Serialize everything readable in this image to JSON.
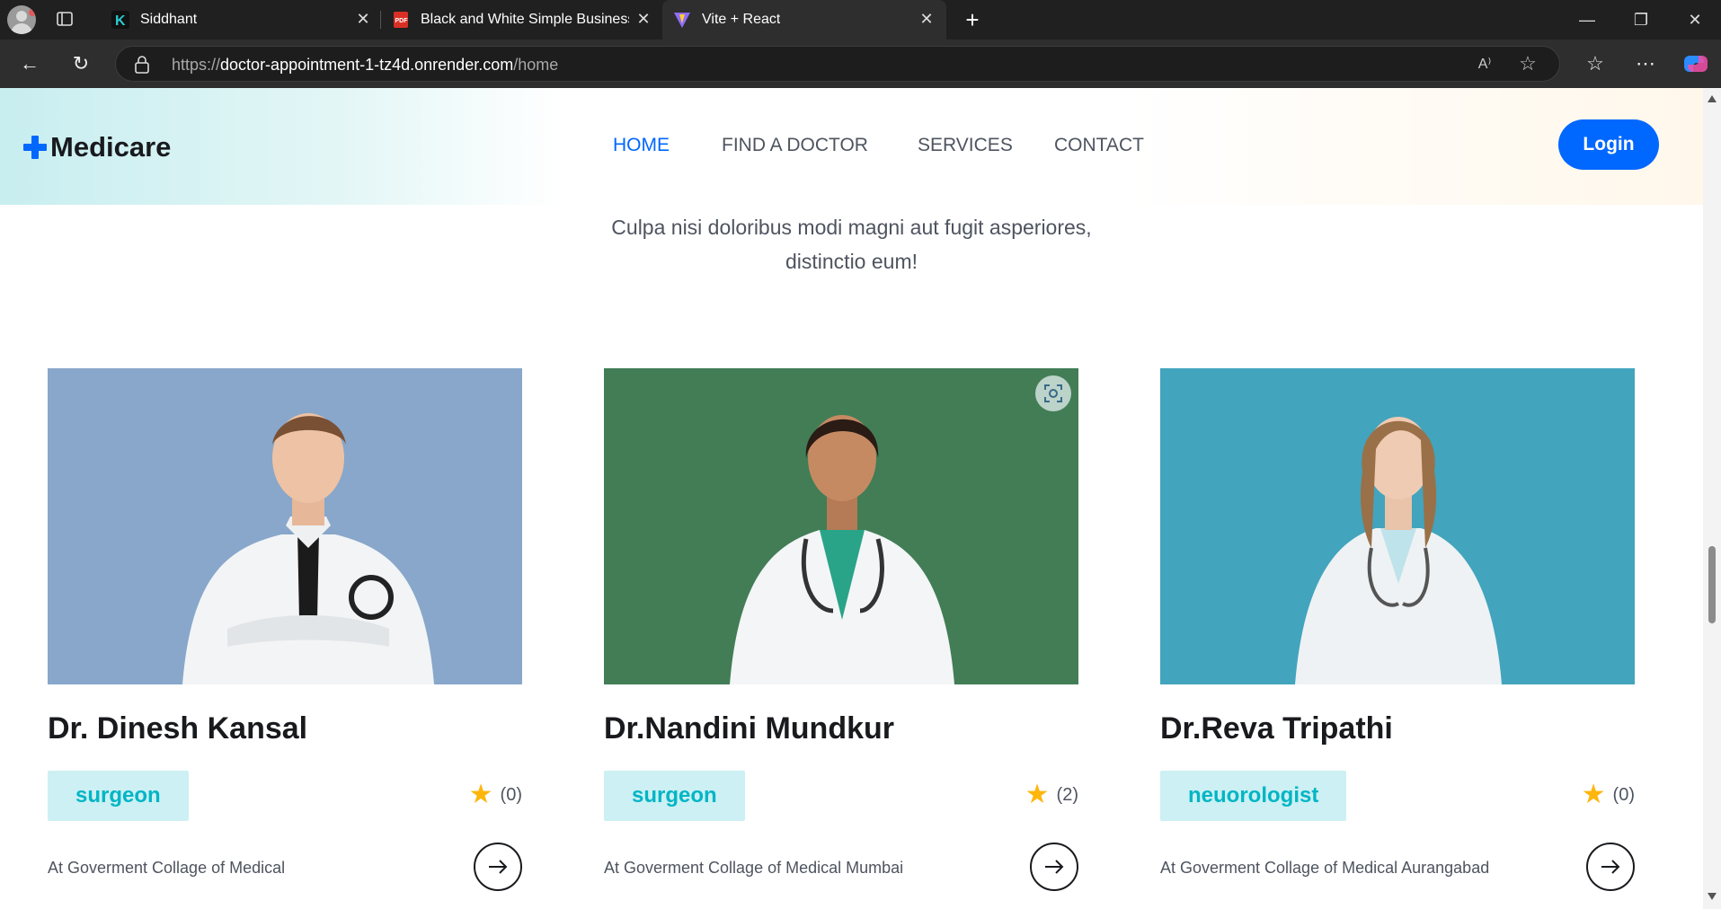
{
  "browser": {
    "tabs": [
      {
        "title": "Siddhant",
        "favicon": "k-logo-icon"
      },
      {
        "title": "Black and White Simple Business",
        "favicon": "pdf-icon"
      },
      {
        "title": "Vite + React",
        "favicon": "vite-icon",
        "active": true
      }
    ],
    "url_prefix": "https://",
    "url_host": "doctor-appointment-1-tz4d.onrender.com",
    "url_path": "/home"
  },
  "site": {
    "logo": "Medicare",
    "nav": [
      "HOME",
      "FIND A DOCTOR",
      "SERVICES",
      "CONTACT"
    ],
    "active_nav": "HOME",
    "login_label": "Login",
    "hero_lines": [
      "Culpa nisi doloribus modi magni aut fugit asperiores,",
      "distinctio eum!"
    ],
    "accent_color": "#0067ff",
    "tag_bg": "#ccf0f3",
    "tag_text": "#01b5c5"
  },
  "doctors": [
    {
      "name": "Dr. Dinesh Kansal",
      "specialty": "surgeon",
      "rating_count": "(0)",
      "hospital": "At Goverment Collage of Medical"
    },
    {
      "name": "Dr.Nandini Mundkur",
      "specialty": "surgeon",
      "rating_count": "(2)",
      "hospital": "At Goverment Collage of Medical Mumbai"
    },
    {
      "name": "Dr.Reva Tripathi",
      "specialty": "neuorologist",
      "rating_count": "(0)",
      "hospital": "At Goverment Collage of Medical Aurangabad"
    }
  ]
}
